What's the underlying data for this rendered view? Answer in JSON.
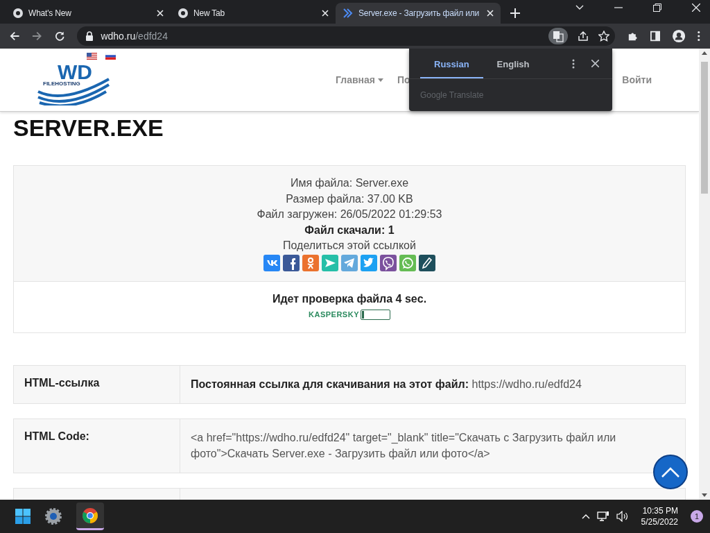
{
  "browser": {
    "tabs": [
      {
        "title": "What's New",
        "selected": false
      },
      {
        "title": "New Tab",
        "selected": false
      },
      {
        "title": "Server.exe - Загрузить файл или",
        "selected": true
      }
    ],
    "address": {
      "host": "wdho.ru",
      "path": "/edfd24"
    },
    "translate_popup": {
      "tabs": [
        {
          "label": "Russian",
          "selected": true
        },
        {
          "label": "English",
          "selected": false
        }
      ],
      "footer": "Google Translate"
    }
  },
  "site": {
    "logo": {
      "text": "WD",
      "subtext": "FILEHOSTING"
    },
    "nav": [
      {
        "label": "Главная",
        "caret": true
      },
      {
        "label": "По",
        "caret": false
      },
      {
        "label": "Войти",
        "caret": false
      }
    ],
    "title": "SERVER.EXE",
    "file_info": [
      "Имя файла: Server.exe",
      "Размер файла: 37.00 KB",
      "Файл загружен: 26/05/2022 01:29:53",
      "**Файл скачали: 1**",
      "Поделиться этой ссылкой"
    ],
    "share_buttons": [
      {
        "kind": "vk",
        "color": "#2787f5"
      },
      {
        "kind": "facebook",
        "color": "#3b5998"
      },
      {
        "kind": "ok",
        "color": "#eb722e"
      },
      {
        "kind": "arrow",
        "color": "#26bfa8"
      },
      {
        "kind": "telegram",
        "color": "#64a9dc"
      },
      {
        "kind": "twitter",
        "color": "#1da1f2"
      },
      {
        "kind": "viber",
        "color": "#7b519d"
      },
      {
        "kind": "whatsapp",
        "color": "#65bc54"
      },
      {
        "kind": "pencil",
        "color": "#1e4f5c"
      }
    ],
    "scan": {
      "text": "Идет проверка файла 4 sec.",
      "vendor": "KASPERSKY",
      "level": 0.08
    },
    "rows": [
      {
        "label": "HTML-ссылка",
        "value": "**Постоянная ссылка для скачивания на этот файл:** https://wdho.ru/edfd24"
      },
      {
        "label": "HTML Code:",
        "value": "<a href=\"https://wdho.ru/edfd24\" target=\"_blank\" title=\"Скачать с Загрузить файл или фото\">Скачать Server.exe - Загрузить файл или фото</a>"
      }
    ]
  },
  "taskbar": {
    "time": "10:35 PM",
    "date": "5/25/2022",
    "notifications": "1"
  }
}
